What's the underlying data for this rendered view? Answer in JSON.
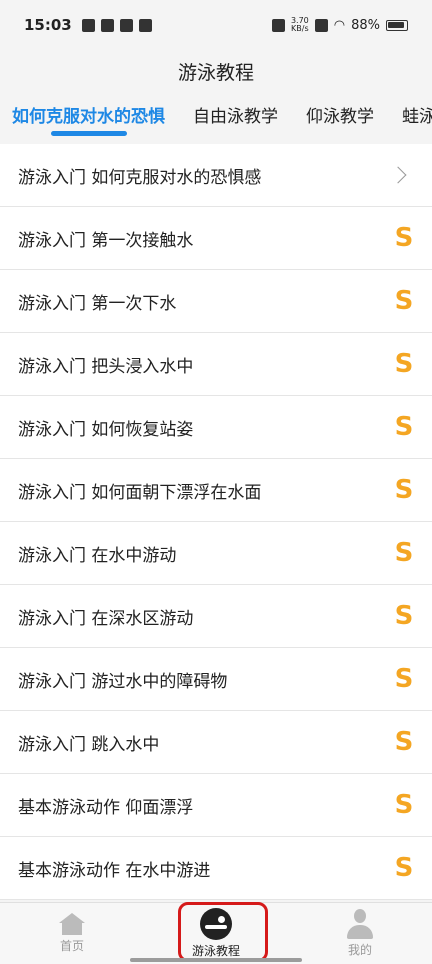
{
  "status": {
    "time": "15:03",
    "net_speed_top": "3.70",
    "net_speed_bottom": "KB/s",
    "battery": "88%"
  },
  "header": {
    "title": "游泳教程"
  },
  "tabs": [
    {
      "label": "如何克服对水的恐惧"
    },
    {
      "label": "自由泳教学"
    },
    {
      "label": "仰泳教学"
    },
    {
      "label": "蛙泳教学"
    }
  ],
  "list": [
    {
      "label": "游泳入门 如何克服对水的恐惧感",
      "badge": "chevron-right-icon"
    },
    {
      "label": "游泳入门 第一次接触水",
      "badge": "coin-icon"
    },
    {
      "label": "游泳入门 第一次下水",
      "badge": "coin-icon"
    },
    {
      "label": "游泳入门 把头浸入水中",
      "badge": "coin-icon"
    },
    {
      "label": "游泳入门 如何恢复站姿",
      "badge": "coin-icon"
    },
    {
      "label": "游泳入门 如何面朝下漂浮在水面",
      "badge": "coin-icon"
    },
    {
      "label": "游泳入门 在水中游动",
      "badge": "coin-icon"
    },
    {
      "label": "游泳入门 在深水区游动",
      "badge": "coin-icon"
    },
    {
      "label": "游泳入门 游过水中的障碍物",
      "badge": "coin-icon"
    },
    {
      "label": "游泳入门 跳入水中",
      "badge": "coin-icon"
    },
    {
      "label": "基本游泳动作 仰面漂浮",
      "badge": "coin-icon"
    },
    {
      "label": "基本游泳动作 在水中游进",
      "badge": "coin-icon"
    }
  ],
  "coin_symbol": "S",
  "nav": {
    "home": "首页",
    "tutorial": "游泳教程",
    "mine": "我的"
  },
  "colors": {
    "accent": "#1e88e5",
    "coin": "#f4a623",
    "highlight": "#d51a1a"
  }
}
